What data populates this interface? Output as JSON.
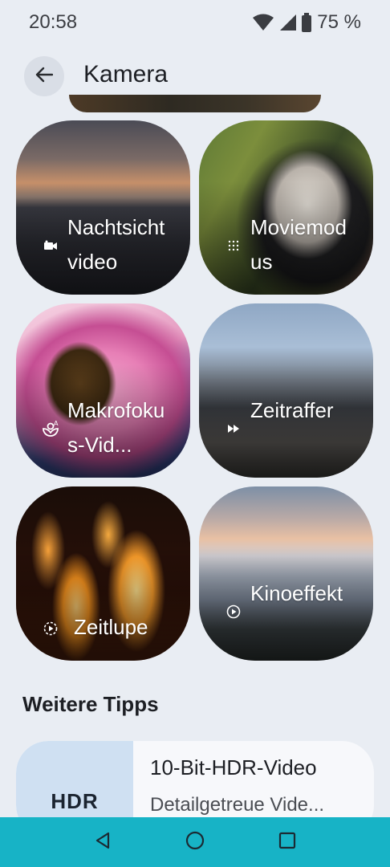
{
  "status_bar": {
    "time": "20:58",
    "battery": "75 %",
    "icons": [
      "wifi-icon",
      "signal-icon",
      "battery-icon"
    ]
  },
  "app_bar": {
    "title": "Kamera",
    "back_icon": "arrow-left-icon"
  },
  "tiles": [
    {
      "label": "Nachtsichtvideo",
      "icon": "video-camera-icon"
    },
    {
      "label": "Moviemodus",
      "icon": "dots-grid-icon"
    },
    {
      "label": "Makrofokus-Vid...",
      "icon": "macro-flower-icon"
    },
    {
      "label": "Zeitraffer",
      "icon": "fast-forward-icon"
    },
    {
      "label": "Zeitlupe",
      "icon": "slow-motion-icon"
    },
    {
      "label": "Kinoeffekt",
      "icon": "cinematic-icon"
    }
  ],
  "more_tips": {
    "heading": "Weitere Tipps",
    "items": [
      {
        "thumb_text": "HDR",
        "title": "10-Bit-HDR-Video",
        "description": "Detailgetreue Vide..."
      }
    ]
  },
  "nav_bar": {
    "color": "#17b3c6",
    "buttons": [
      "back-triangle-icon",
      "home-circle-icon",
      "recents-square-icon"
    ]
  }
}
